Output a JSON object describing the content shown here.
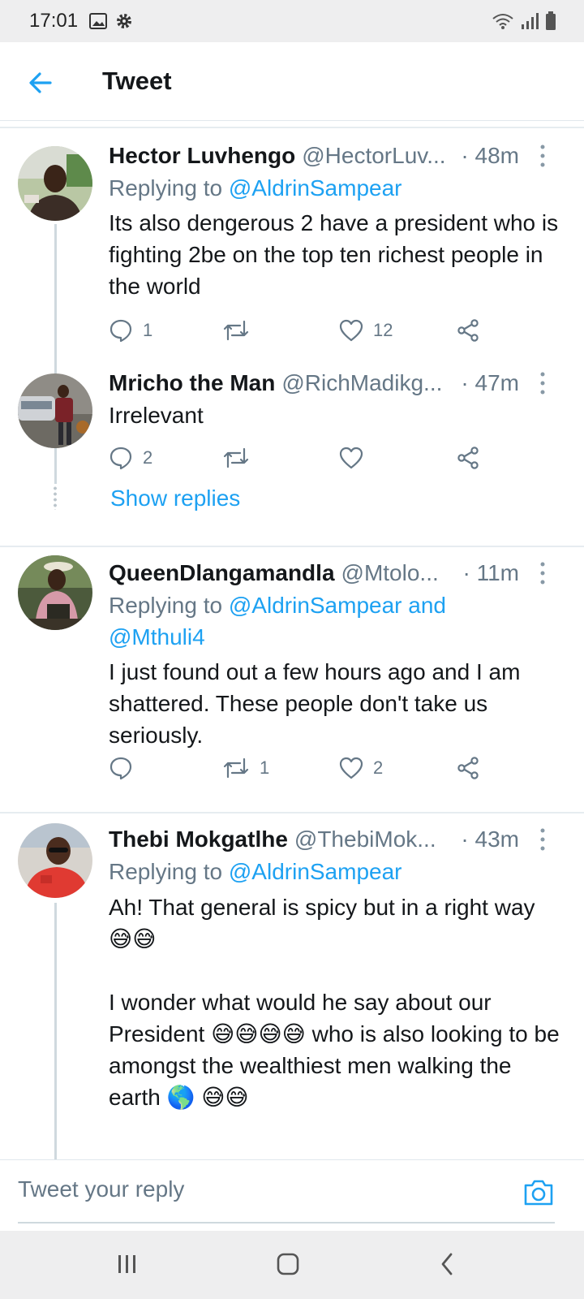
{
  "status_bar": {
    "time": "17:01"
  },
  "header": {
    "title": "Tweet"
  },
  "tweets": [
    {
      "name": "Hector Luvhengo",
      "handle": "@HectorLuv...",
      "age": "· 48m",
      "replying_prefix": "Replying to ",
      "replying_to": "@AldrinSampear",
      "text": "Its also dengerous 2 have a president who is fighting 2be on the top ten richest people in the world",
      "replies": "1",
      "retweets": "",
      "likes": "12"
    },
    {
      "name": "Mricho the Man",
      "handle": "@RichMadikg...",
      "age": "· 47m",
      "text": "Irrelevant",
      "replies": "2",
      "retweets": "",
      "likes": "",
      "show_replies": "Show replies"
    },
    {
      "name": "QueenDlangamandla",
      "handle": "@Mtolo...",
      "age": "· 11m",
      "replying_prefix": "Replying to ",
      "replying_to": "@AldrinSampear and",
      "replying_to_2": "@Mthuli4",
      "text": "I just found out a few hours ago and I am shattered. These people don't take us seriously.",
      "replies": "",
      "retweets": "1",
      "likes": "2"
    },
    {
      "name": "Thebi Mokgatlhe",
      "handle": "@ThebiMok...",
      "age": "· 43m",
      "replying_prefix": "Replying to ",
      "replying_to": "@AldrinSampear",
      "text_p1": "Ah! That general is spicy but in a right way 😅😅",
      "text_p2": "I wonder what would he say about our President 😅😅😅😅 who is also looking to be amongst the wealthiest men walking the earth 🌎 😅😅"
    }
  ],
  "reply_bar": {
    "placeholder": "Tweet your reply"
  },
  "colors": {
    "accent": "#1da1f2",
    "secondary_text": "#657786",
    "divider": "#e6ecf0"
  }
}
